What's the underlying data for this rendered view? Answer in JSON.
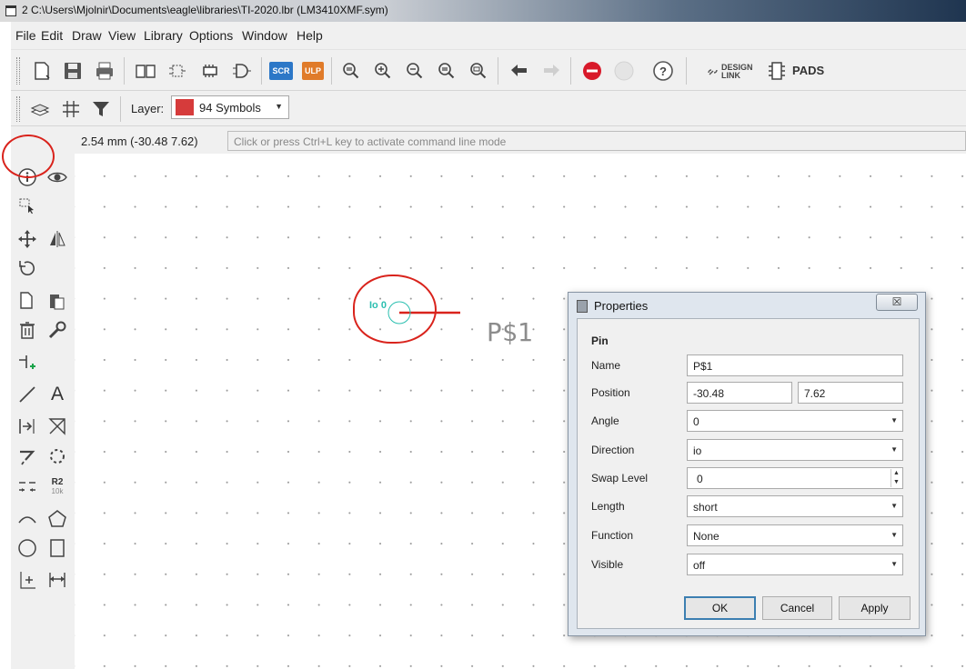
{
  "window": {
    "title": "2 C:\\Users\\Mjolnir\\Documents\\eagle\\libraries\\TI-2020.lbr (LM3410XMF.sym)"
  },
  "menu": [
    "File",
    "Edit",
    "Draw",
    "View",
    "Library",
    "Options",
    "Window",
    "Help"
  ],
  "toolbar": {
    "scr_label": "SCR",
    "ulp_label": "ULP",
    "go_label": "GO",
    "help_label": "?",
    "design_link_line1": "DESIGN",
    "design_link_line2": "LINK",
    "pads_label": "PADS"
  },
  "layer_bar": {
    "label": "Layer:",
    "selected_layer": "94 Symbols",
    "layer_color": "#d63b3b"
  },
  "status": {
    "coordinates": "2.54 mm (-30.48 7.62)",
    "command_placeholder": "Click or press Ctrl+L key to activate command line mode"
  },
  "left_tools": {
    "r2_label": "R2",
    "r2_sublabel": "10k",
    "text_tool_label": "A"
  },
  "canvas": {
    "pin_name": "P$1",
    "pin_direction_marker": "Io 0",
    "pin_color": "#d9231c",
    "origin_color": "#2bbfb0"
  },
  "properties_dialog": {
    "title": "Properties",
    "close_glyph": "☒",
    "section": "Pin",
    "fields": [
      {
        "label": "Name",
        "value": "P$1"
      },
      {
        "label": "Position",
        "value_x": "-30.48",
        "value_y": "7.62"
      },
      {
        "label": "Angle",
        "value": "0"
      },
      {
        "label": "Direction",
        "value": "io"
      },
      {
        "label": "Swap Level",
        "value": "0"
      },
      {
        "label": "Length",
        "value": "short"
      },
      {
        "label": "Function",
        "value": "None"
      },
      {
        "label": "Visible",
        "value": "off"
      }
    ],
    "buttons": {
      "ok": "OK",
      "cancel": "Cancel",
      "apply": "Apply"
    }
  }
}
